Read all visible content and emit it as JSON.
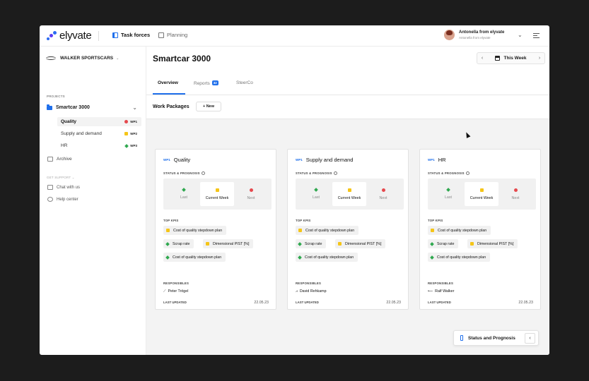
{
  "app": {
    "logo": "elyvate"
  },
  "nav": {
    "task_forces": "Task forces",
    "planning": "Planning"
  },
  "user": {
    "name": "Antonella from elyvate",
    "subtitle": "Antonella from elyvate"
  },
  "sidebar": {
    "org": "WALKER SPORTSCARS",
    "projects_label": "PROJECTS",
    "project": "Smartcar 3000",
    "workpackages": [
      {
        "label": "Quality",
        "code": "WP1",
        "status": "red"
      },
      {
        "label": "Supply and demand",
        "code": "WP2",
        "status": "yellow"
      },
      {
        "label": "HR",
        "code": "WP3",
        "status": "green"
      }
    ],
    "archive": "Archive",
    "support_label": "GET SUPPORT",
    "chat": "Chat with us",
    "help": "Help center"
  },
  "header": {
    "title": "Smartcar 3000",
    "week": "This Week",
    "prev": "‹",
    "next": "›"
  },
  "tabs": [
    {
      "label": "Overview"
    },
    {
      "label": "Reports",
      "badge": "32"
    },
    {
      "label": "SteerCo"
    }
  ],
  "workpackages_section": {
    "title": "Work Packages",
    "new_button": "+  New"
  },
  "labels": {
    "status": "STATUS & PROGNOSIS",
    "last": "Last",
    "current": "Current Week",
    "next": "Next",
    "kpis": "TOP KPIS",
    "responsibles": "RESPONSIBLES",
    "last_updated": "LAST UPDATED"
  },
  "cards": [
    {
      "code": "WP1",
      "title": "Quality",
      "status": {
        "last": "green",
        "current": "yellow",
        "next": "red"
      },
      "kpis": [
        {
          "label": "Cost of quality stepdown plan",
          "status": "yellow"
        },
        {
          "label": "Scrap rate",
          "status": "green"
        },
        {
          "label": "Dimensional PIST [%]",
          "status": "yellow"
        },
        {
          "label": "Cost of quality stepdown plan",
          "status": "green"
        }
      ],
      "responsible": "Peter Trögel",
      "updated": "22.05.23"
    },
    {
      "code": "WP1",
      "title": "Supply and demand",
      "status": {
        "last": "green",
        "current": "yellow",
        "next": "red"
      },
      "kpis": [
        {
          "label": "Cost of quality stepdown plan",
          "status": "yellow"
        },
        {
          "label": "Scrap rate",
          "status": "green"
        },
        {
          "label": "Dimensional PIST [%]",
          "status": "yellow"
        },
        {
          "label": "Cost of quality stepdown plan",
          "status": "green"
        }
      ],
      "responsible": "David Rehkamp",
      "updated": "22.05.23"
    },
    {
      "code": "WP1",
      "title": "HR",
      "status": {
        "last": "green",
        "current": "yellow",
        "next": "red"
      },
      "kpis": [
        {
          "label": "Cost of quality stepdown plan",
          "status": "yellow"
        },
        {
          "label": "Scrap rate",
          "status": "green"
        },
        {
          "label": "Dimensional PIST [%]",
          "status": "yellow"
        },
        {
          "label": "Cost of quality stepdown plan",
          "status": "green"
        }
      ],
      "responsible": "Ralf Walker",
      "updated": "22.05.23"
    }
  ],
  "status_panel": {
    "label": "Status and Prognosis",
    "toggle": "‹"
  },
  "colors": {
    "accent": "#1f6feb",
    "red": "#e5484d",
    "yellow": "#f5c518",
    "green": "#2fa84f"
  },
  "icons": [
    "logo-icon",
    "task-forces-icon",
    "planning-icon",
    "settings-icon",
    "folder-icon",
    "archive-icon",
    "chat-icon",
    "help-icon",
    "calendar-icon",
    "info-icon",
    "status-prognosis-icon"
  ]
}
